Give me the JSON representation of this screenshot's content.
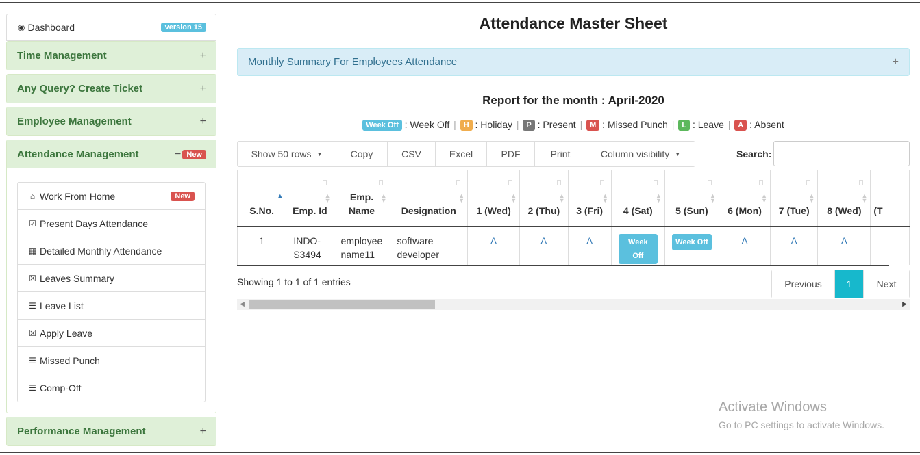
{
  "sidebar": {
    "dashboard": {
      "label": "Dashboard",
      "version": "version 15"
    },
    "sections": {
      "time": "Time Management",
      "query": "Any Query? Create Ticket",
      "employee": "Employee Management",
      "attendance": "Attendance Management",
      "attendance_badge": "New",
      "performance": "Performance Management"
    },
    "attendance_items": [
      {
        "label": "Work From Home",
        "badge": "New"
      },
      {
        "label": "Present Days Attendance"
      },
      {
        "label": "Detailed Monthly Attendance"
      },
      {
        "label": "Leaves Summary"
      },
      {
        "label": "Leave List"
      },
      {
        "label": "Apply Leave"
      },
      {
        "label": "Missed Punch"
      },
      {
        "label": "Comp-Off"
      }
    ],
    "plus": "+",
    "minus": "−"
  },
  "main": {
    "title": "Attendance Master Sheet",
    "summary_link": "Monthly Summary For Employees Attendance",
    "report_title": "Report for the month : April-2020",
    "legend": {
      "week_off_badge": "Week Off",
      "week_off": ": Week Off",
      "holiday_badge": "H",
      "holiday": ": Holiday",
      "present_badge": "P",
      "present": ": Present",
      "missed_badge": "M",
      "missed": ": Missed Punch",
      "leave_badge": "L",
      "leave": ": Leave",
      "absent_badge": "A",
      "absent": ": Absent",
      "sep": "|"
    },
    "toolbar": {
      "show_rows": "Show 50 rows",
      "copy": "Copy",
      "csv": "CSV",
      "excel": "Excel",
      "pdf": "PDF",
      "print": "Print",
      "colvis": "Column visibility"
    },
    "search_label": "Search:",
    "table": {
      "headers": [
        "S.No.",
        "Emp. Id",
        "Emp. Name",
        "Designation",
        "1 (Wed)",
        "2 (Thu)",
        "3 (Fri)",
        "4 (Sat)",
        "5 (Sun)",
        "6 (Mon)",
        "7 (Tue)",
        "8 (Wed)",
        "(T"
      ],
      "row": {
        "sno": "1",
        "empid": "INDO-S3494",
        "name": "employee name11",
        "designation": "software developer",
        "d1": "A",
        "d2": "A",
        "d3": "A",
        "d4": "Week Off",
        "d5": "Week Off",
        "d6": "A",
        "d7": "A",
        "d8": "A"
      }
    },
    "showing": "Showing 1 to 1 of 1 entries",
    "pager": {
      "previous": "Previous",
      "page": "1",
      "next": "Next"
    }
  },
  "watermark": {
    "line1": "Activate Windows",
    "line2": "Go to PC settings to activate Windows."
  },
  "colors": {
    "panel_bg": "#dff0d8",
    "panel_text": "#3c763d",
    "info_bg": "#d9edf7",
    "week_off": "#5bc0de",
    "holiday": "#f0ad4e",
    "present": "#777777",
    "missed": "#d9534f",
    "leave": "#5cb85c",
    "absent": "#d9534f",
    "active_page": "#17b8cc"
  }
}
